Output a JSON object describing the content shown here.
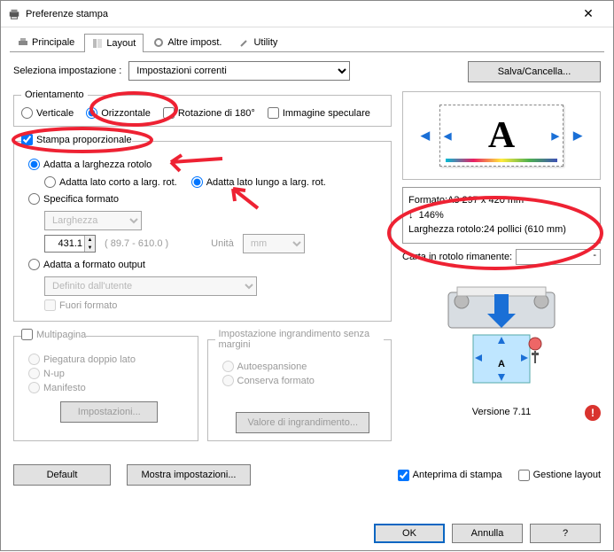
{
  "window": {
    "title": "Preferenze stampa"
  },
  "tabs": {
    "main": "Principale",
    "layout": "Layout",
    "other": "Altre impost.",
    "utility": "Utility"
  },
  "settings": {
    "select_label": "Seleziona impostazione :",
    "combo_value": "Impostazioni correnti",
    "save_btn": "Salva/Cancella..."
  },
  "orientation": {
    "legend": "Orientamento",
    "vertical": "Verticale",
    "horizontal": "Orizzontale",
    "rotate180": "Rotazione di 180°",
    "mirror": "Immagine speculare"
  },
  "proportional": {
    "label": "Stampa proporzionale",
    "fit_roll": "Adatta a larghezza rotolo",
    "fit_short": "Adatta lato corto a larg. rot.",
    "fit_long": "Adatta lato lungo a larg. rot.",
    "specify_fmt": "Specifica formato",
    "width_label": "Larghezza",
    "width_value": "431.1",
    "width_range": "( 89.7 - 610.0 )",
    "unit_label": "Unità",
    "unit_value": "mm",
    "fit_output": "Adatta a formato output",
    "userdef": "Definito dall'utente",
    "oversize": "Fuori formato"
  },
  "multipage": {
    "legend": "Multipagina",
    "fold": "Piegatura doppio lato",
    "nup": "N-up",
    "poster": "Manifesto",
    "settings_btn": "Impostazioni..."
  },
  "borderless": {
    "legend": "Impostazione ingrandimento senza margini",
    "autoexp": "Autoespansione",
    "retain": "Conserva formato",
    "amount_btn": "Valore di ingrandimento..."
  },
  "info": {
    "format": "Formato:A3 297 x 420 mm",
    "scale_arrow": "↓",
    "scale": "146%",
    "rollwidth": "Larghezza rotolo:24 pollici (610 mm)",
    "roll_remaining_label": "Carta in rotolo rimanente:",
    "roll_remaining_value": "-",
    "version": "Versione 7.11"
  },
  "bottom": {
    "default": "Default",
    "show": "Mostra impostazioni...",
    "preview": "Anteprima di stampa",
    "layoutmgr": "Gestione layout"
  },
  "dialog": {
    "ok": "OK",
    "cancel": "Annulla",
    "help": "?"
  }
}
